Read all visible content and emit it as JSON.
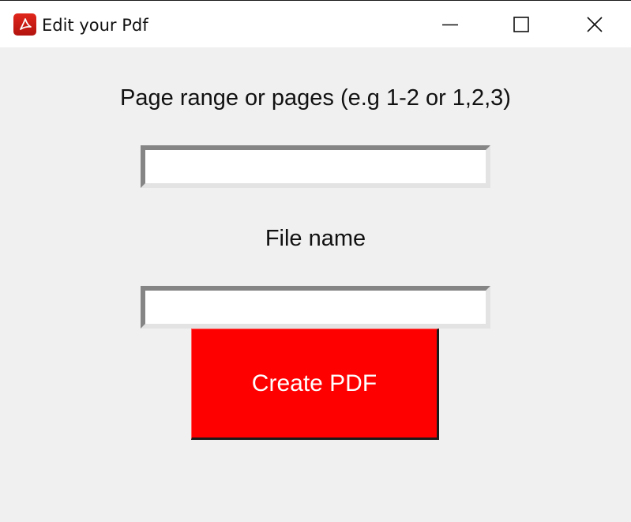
{
  "window": {
    "title": "Edit your Pdf",
    "icon": "pdf-icon",
    "controls": [
      "minimize-icon",
      "maximize-icon",
      "close-icon"
    ]
  },
  "form": {
    "range_label": "Page range or pages (e.g 1-2 or 1,2,3)",
    "range_value": "",
    "file_label": "File name",
    "file_value": "",
    "submit_label": "Create PDF"
  },
  "colors": {
    "titlebar_bg": "#ffffff",
    "window_bg": "#f0f0f0",
    "button_bg": "#ff0000",
    "button_text": "#ffffff",
    "icon_red": "#d2231a"
  }
}
